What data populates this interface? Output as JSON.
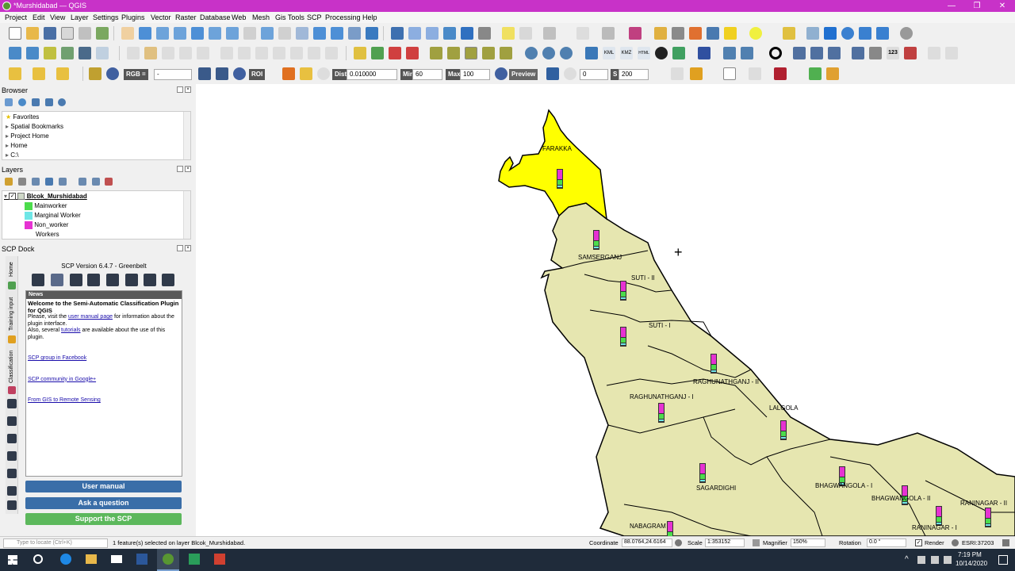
{
  "window": {
    "title": "*Murshidabad — QGIS",
    "minimize": "—",
    "restore": "❐",
    "close": "✕"
  },
  "menu": [
    "Project",
    "Edit",
    "View",
    "Layer",
    "Settings",
    "Plugins",
    "Vector",
    "Raster",
    "Database",
    "Web",
    "Mesh",
    "Gis Tools",
    "SCP",
    "Processing",
    "Help"
  ],
  "scp_toolbar": {
    "rgb_label": "RGB =",
    "rgb_value": "-",
    "roi_label": "ROI",
    "dist_label": "Dist",
    "dist_value": "0.010000",
    "min_label": "Min",
    "min_value": "60",
    "max_label": "Max",
    "max_value": "100",
    "preview_label": "Preview",
    "t_value": "0",
    "s_label": "S",
    "s_value": "200"
  },
  "browser": {
    "title": "Browser",
    "items": [
      "Favorites",
      "Spatial Bookmarks",
      "Project Home",
      "Home",
      "C:\\"
    ]
  },
  "layers": {
    "title": "Layers",
    "layer_name": "Blcok_Murshidabad",
    "legend": [
      {
        "label": "Mainworker",
        "color": "#4cdc4c"
      },
      {
        "label": "Marginal Worker",
        "color": "#6ee6e6"
      },
      {
        "label": "Non_worker",
        "color": "#e632d2"
      }
    ],
    "attribute_label": "Workers"
  },
  "scp": {
    "title": "SCP Dock",
    "version": "SCP Version 6.4.7 - Greenbelt",
    "news_header": "News",
    "welcome_title": "Welcome to the Semi-Automatic Classification Plugin for QGIS",
    "line1_a": "Please, visit the ",
    "line1_link": "user manual page",
    "line1_b": " for information about the plugin interface.",
    "line2_a": "Also, several ",
    "line2_link": "tutorials",
    "line2_b": " are available about the use of this plugin.",
    "link_facebook": "SCP group in Facebook",
    "link_google": "SCP community in Google+",
    "link_gis": "From GIS to Remote Sensing",
    "btn_manual": "User manual",
    "btn_question": "Ask a question",
    "btn_support": "Support the SCP",
    "vtab_home": "Home",
    "vtab_training": "Training input",
    "vtab_classification": "Classification"
  },
  "map": {
    "labels": [
      "FARAKKA",
      "SAMSERGANJ",
      "SUTI - II",
      "SUTI - I",
      "RAGHUNATHGANJ - II",
      "RAGHUNATHGANJ - I",
      "LALGOLA",
      "SAGARDIGHI",
      "BHAGWANGOLA - I",
      "BHAGWANGOLA - II",
      "RANINAGAR - II",
      "RANINAGAR - I",
      "NABAGRAM"
    ],
    "fill_selected": "#ffff00",
    "fill_default": "#e6e6b0",
    "bars": [
      {
        "block": "FARAKKA",
        "non_worker": 0.55,
        "main": 0.3,
        "marginal": 0.15
      },
      {
        "block": "SAMSERGANJ",
        "non_worker": 0.55,
        "main": 0.3,
        "marginal": 0.15
      },
      {
        "block": "SUTI - II",
        "non_worker": 0.55,
        "main": 0.3,
        "marginal": 0.15
      },
      {
        "block": "SUTI - I",
        "non_worker": 0.55,
        "main": 0.3,
        "marginal": 0.15
      },
      {
        "block": "RAGHUNATHGANJ - II",
        "non_worker": 0.55,
        "main": 0.3,
        "marginal": 0.15
      },
      {
        "block": "RAGHUNATHGANJ - I",
        "non_worker": 0.55,
        "main": 0.3,
        "marginal": 0.15
      },
      {
        "block": "LALGOLA",
        "non_worker": 0.55,
        "main": 0.3,
        "marginal": 0.15
      },
      {
        "block": "SAGARDIGHI",
        "non_worker": 0.55,
        "main": 0.3,
        "marginal": 0.15
      },
      {
        "block": "BHAGWANGOLA - I",
        "non_worker": 0.55,
        "main": 0.3,
        "marginal": 0.15
      },
      {
        "block": "BHAGWANGOLA - II",
        "non_worker": 0.55,
        "main": 0.3,
        "marginal": 0.15
      },
      {
        "block": "RANINAGAR - II",
        "non_worker": 0.55,
        "main": 0.3,
        "marginal": 0.15
      },
      {
        "block": "RANINAGAR - I",
        "non_worker": 0.55,
        "main": 0.3,
        "marginal": 0.15
      },
      {
        "block": "NABAGRAM",
        "non_worker": 0.55,
        "main": 0.3,
        "marginal": 0.15
      }
    ]
  },
  "status": {
    "locate_placeholder": "Type to locate (Ctrl+K)",
    "message": "1 feature(s) selected on layer Blcok_Murshidabad.",
    "coord_label": "Coordinate",
    "coord_value": "88.0764,24.6164",
    "scale_label": "Scale",
    "scale_value": "1:353152",
    "magnifier_label": "Magnifier",
    "magnifier_value": "150%",
    "rotation_label": "Rotation",
    "rotation_value": "0.0 °",
    "render_label": "Render",
    "crs": "ESRI:37203"
  },
  "taskbar": {
    "time": "7:19 PM",
    "date": "10/14/2020"
  }
}
